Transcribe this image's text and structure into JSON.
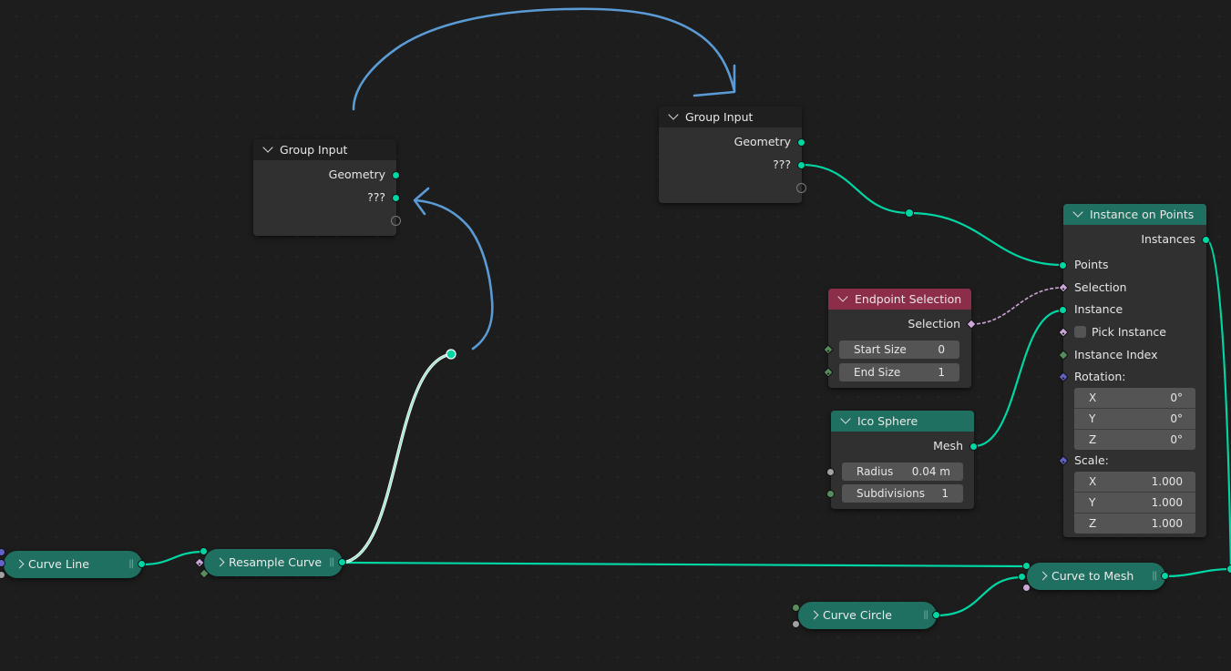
{
  "editor": "Geometry Node Editor",
  "colors": {
    "background": "#1d1d1d",
    "node_body": "#303030",
    "header_geometry": "#1f7060",
    "header_input": "#8c2e4a",
    "header_group": "#1f1f1f",
    "link_geometry": "#00d6a3",
    "link_bool": "#cca6d6",
    "annotation": "#5b9bd5"
  },
  "nodes": {
    "group_input_left": {
      "title": "Group Input",
      "outputs": [
        "Geometry",
        "???"
      ]
    },
    "group_input_right": {
      "title": "Group Input",
      "outputs": [
        "Geometry",
        "???"
      ]
    },
    "instance_on_points": {
      "title": "Instance on Points",
      "output": "Instances",
      "inputs": [
        "Points",
        "Selection",
        "Instance",
        "Pick Instance",
        "Instance Index",
        "Rotation:",
        "Scale:"
      ],
      "rotation": [
        {
          "axis": "X",
          "value": "0°"
        },
        {
          "axis": "Y",
          "value": "0°"
        },
        {
          "axis": "Z",
          "value": "0°"
        }
      ],
      "scale": [
        {
          "axis": "X",
          "value": "1.000"
        },
        {
          "axis": "Y",
          "value": "1.000"
        },
        {
          "axis": "Z",
          "value": "1.000"
        }
      ],
      "pick_instance_checked": false
    },
    "endpoint_selection": {
      "title": "Endpoint Selection",
      "output": "Selection",
      "fields": [
        {
          "label": "Start Size",
          "value": "0"
        },
        {
          "label": "End Size",
          "value": "1"
        }
      ]
    },
    "ico_sphere": {
      "title": "Ico Sphere",
      "output": "Mesh",
      "fields": [
        {
          "label": "Radius",
          "value": "0.04 m"
        },
        {
          "label": "Subdivisions",
          "value": "1"
        }
      ]
    },
    "curve_line": {
      "title": "Curve Line"
    },
    "resample_curve": {
      "title": "Resample Curve"
    },
    "curve_to_mesh": {
      "title": "Curve to Mesh"
    },
    "curve_circle": {
      "title": "Curve Circle"
    }
  }
}
